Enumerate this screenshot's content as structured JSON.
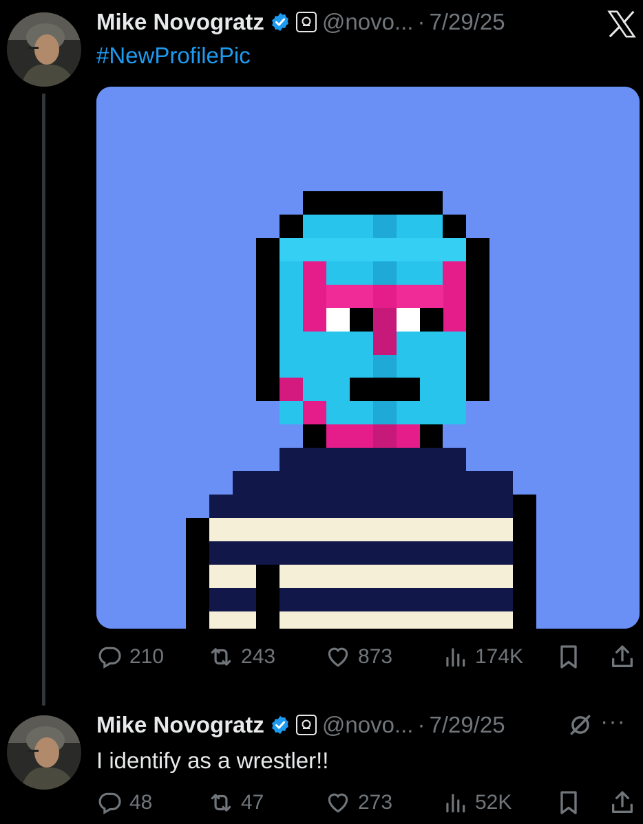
{
  "tweet1": {
    "name": "Mike Novogratz",
    "handle": "@novo...",
    "separator": "·",
    "date": "7/29/25",
    "text": "#NewProfilePic",
    "stats": {
      "replies": "210",
      "retweets": "243",
      "likes": "873",
      "views": "174K"
    }
  },
  "tweet2": {
    "name": "Mike Novogratz",
    "handle": "@novo...",
    "separator": "·",
    "date": "7/29/25",
    "text": "I identify as a wrestler!!",
    "more": "···",
    "stats": {
      "replies": "48",
      "retweets": "47",
      "likes": "273",
      "views": "52K"
    }
  },
  "icons": {
    "brand": "x-logo-icon",
    "verified": "verified-badge-icon",
    "affiliate": "affiliate-badge-icon",
    "reply": "reply-icon",
    "retweet": "retweet-icon",
    "like": "heart-icon",
    "views": "views-icon",
    "bookmark": "bookmark-icon",
    "share": "share-icon",
    "grok": "grok-icon"
  },
  "colors": {
    "background": "#000000",
    "text": "#e7e9ea",
    "muted": "#71767b",
    "link": "#1d9bf0",
    "verified": "#1d9bf0",
    "media_background": "#6a8ff5"
  }
}
